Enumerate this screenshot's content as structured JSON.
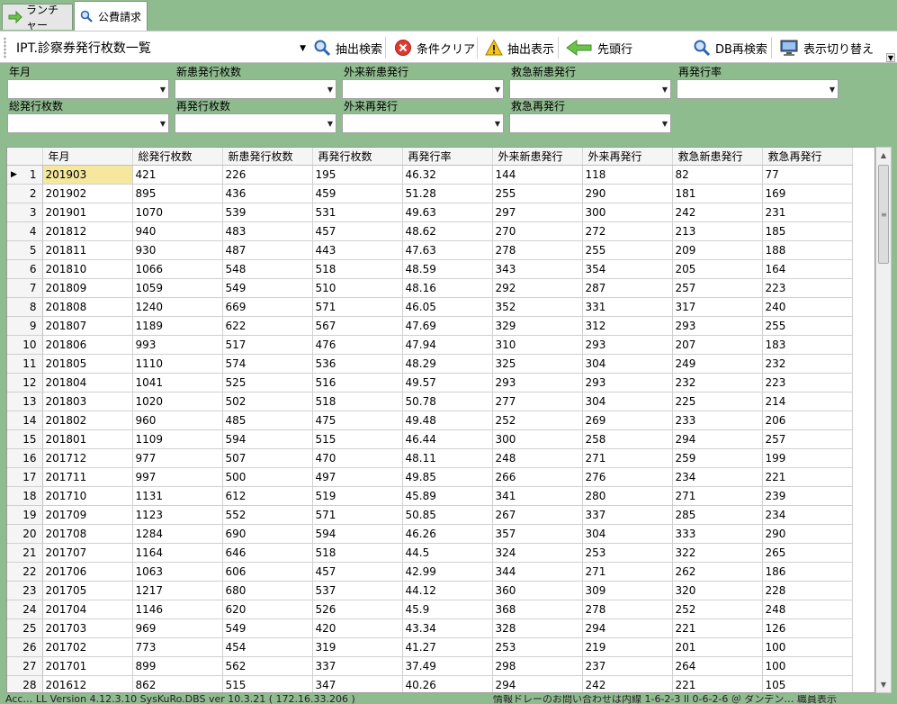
{
  "tabs": [
    {
      "label": "ランチャー",
      "icon": "arrow-right-icon",
      "active": false
    },
    {
      "label": "公費請求",
      "icon": "search-icon",
      "active": true
    }
  ],
  "toolbar": {
    "report_title": "IPT.診察券発行枚数一覧",
    "buttons": {
      "extract_search": "抽出検索",
      "clear_conditions": "条件クリア",
      "extract_show": "抽出表示",
      "go_first": "先頭行",
      "db_research": "DB再検索",
      "switch_view": "表示切り替え"
    }
  },
  "filters": [
    {
      "label": "年月",
      "value": ""
    },
    {
      "label": "新患発行枚数",
      "value": ""
    },
    {
      "label": "外来新患発行",
      "value": ""
    },
    {
      "label": "救急新患発行",
      "value": ""
    },
    {
      "label": "再発行率",
      "value": ""
    },
    {
      "label": "総発行枚数",
      "value": ""
    },
    {
      "label": "再発行枚数",
      "value": ""
    },
    {
      "label": "外来再発行",
      "value": ""
    },
    {
      "label": "救急再発行",
      "value": ""
    }
  ],
  "grid": {
    "columns": [
      "年月",
      "総発行枚数",
      "新患発行枚数",
      "再発行枚数",
      "再発行率",
      "外来新患発行",
      "外来再発行",
      "救急新患発行",
      "救急再発行"
    ],
    "rows": [
      [
        "1",
        "201903",
        "421",
        "226",
        "195",
        "46.32",
        "144",
        "118",
        "82",
        "77"
      ],
      [
        "2",
        "201902",
        "895",
        "436",
        "459",
        "51.28",
        "255",
        "290",
        "181",
        "169"
      ],
      [
        "3",
        "201901",
        "1070",
        "539",
        "531",
        "49.63",
        "297",
        "300",
        "242",
        "231"
      ],
      [
        "4",
        "201812",
        "940",
        "483",
        "457",
        "48.62",
        "270",
        "272",
        "213",
        "185"
      ],
      [
        "5",
        "201811",
        "930",
        "487",
        "443",
        "47.63",
        "278",
        "255",
        "209",
        "188"
      ],
      [
        "6",
        "201810",
        "1066",
        "548",
        "518",
        "48.59",
        "343",
        "354",
        "205",
        "164"
      ],
      [
        "7",
        "201809",
        "1059",
        "549",
        "510",
        "48.16",
        "292",
        "287",
        "257",
        "223"
      ],
      [
        "8",
        "201808",
        "1240",
        "669",
        "571",
        "46.05",
        "352",
        "331",
        "317",
        "240"
      ],
      [
        "9",
        "201807",
        "1189",
        "622",
        "567",
        "47.69",
        "329",
        "312",
        "293",
        "255"
      ],
      [
        "10",
        "201806",
        "993",
        "517",
        "476",
        "47.94",
        "310",
        "293",
        "207",
        "183"
      ],
      [
        "11",
        "201805",
        "1110",
        "574",
        "536",
        "48.29",
        "325",
        "304",
        "249",
        "232"
      ],
      [
        "12",
        "201804",
        "1041",
        "525",
        "516",
        "49.57",
        "293",
        "293",
        "232",
        "223"
      ],
      [
        "13",
        "201803",
        "1020",
        "502",
        "518",
        "50.78",
        "277",
        "304",
        "225",
        "214"
      ],
      [
        "14",
        "201802",
        "960",
        "485",
        "475",
        "49.48",
        "252",
        "269",
        "233",
        "206"
      ],
      [
        "15",
        "201801",
        "1109",
        "594",
        "515",
        "46.44",
        "300",
        "258",
        "294",
        "257"
      ],
      [
        "16",
        "201712",
        "977",
        "507",
        "470",
        "48.11",
        "248",
        "271",
        "259",
        "199"
      ],
      [
        "17",
        "201711",
        "997",
        "500",
        "497",
        "49.85",
        "266",
        "276",
        "234",
        "221"
      ],
      [
        "18",
        "201710",
        "1131",
        "612",
        "519",
        "45.89",
        "341",
        "280",
        "271",
        "239"
      ],
      [
        "19",
        "201709",
        "1123",
        "552",
        "571",
        "50.85",
        "267",
        "337",
        "285",
        "234"
      ],
      [
        "20",
        "201708",
        "1284",
        "690",
        "594",
        "46.26",
        "357",
        "304",
        "333",
        "290"
      ],
      [
        "21",
        "201707",
        "1164",
        "646",
        "518",
        "44.5",
        "324",
        "253",
        "322",
        "265"
      ],
      [
        "22",
        "201706",
        "1063",
        "606",
        "457",
        "42.99",
        "344",
        "271",
        "262",
        "186"
      ],
      [
        "23",
        "201705",
        "1217",
        "680",
        "537",
        "44.12",
        "360",
        "309",
        "320",
        "228"
      ],
      [
        "24",
        "201704",
        "1146",
        "620",
        "526",
        "45.9",
        "368",
        "278",
        "252",
        "248"
      ],
      [
        "25",
        "201703",
        "969",
        "549",
        "420",
        "43.34",
        "328",
        "294",
        "221",
        "126"
      ],
      [
        "26",
        "201702",
        "773",
        "454",
        "319",
        "41.27",
        "253",
        "219",
        "201",
        "100"
      ],
      [
        "27",
        "201701",
        "899",
        "562",
        "337",
        "37.49",
        "298",
        "237",
        "264",
        "100"
      ],
      [
        "28",
        "201612",
        "862",
        "515",
        "347",
        "40.26",
        "294",
        "242",
        "221",
        "105"
      ]
    ]
  },
  "status": {
    "left": "Acc…  LL Version 4.12.3.10    SysKuRo.DBS  ver  10.3.21  ( 172.16.33.206 )",
    "right": "情報ドレーのお問い合わせは内線 1-6-2-3  ll  0-6-2-6  ＠ ダンデン…  職員表示"
  }
}
